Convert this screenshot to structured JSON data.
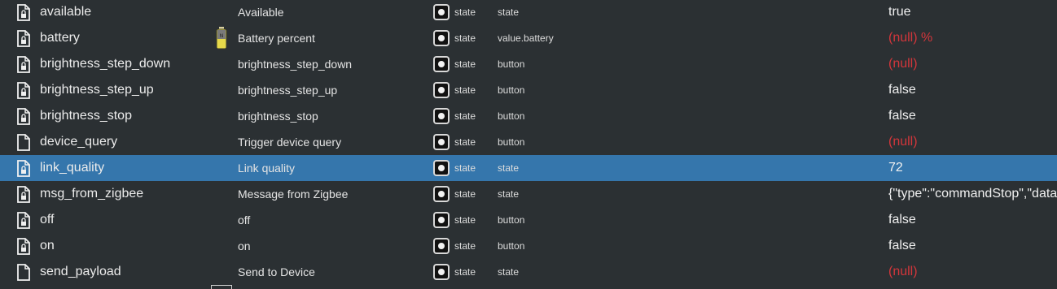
{
  "rows": [
    {
      "id": "available",
      "name": "Available",
      "type": "state",
      "role": "state",
      "value": "true",
      "value_kind": "normal",
      "locked": true,
      "role_icon": ""
    },
    {
      "id": "battery",
      "name": "Battery percent",
      "type": "state",
      "role": "value.battery",
      "value": "(null) %",
      "value_kind": "null",
      "locked": true,
      "role_icon": "battery-icon"
    },
    {
      "id": "brightness_step_down",
      "name": "brightness_step_down",
      "type": "state",
      "role": "button",
      "value": "(null)",
      "value_kind": "null",
      "locked": true,
      "role_icon": ""
    },
    {
      "id": "brightness_step_up",
      "name": "brightness_step_up",
      "type": "state",
      "role": "button",
      "value": "false",
      "value_kind": "normal",
      "locked": true,
      "role_icon": ""
    },
    {
      "id": "brightness_stop",
      "name": "brightness_stop",
      "type": "state",
      "role": "button",
      "value": "false",
      "value_kind": "normal",
      "locked": true,
      "role_icon": ""
    },
    {
      "id": "device_query",
      "name": "Trigger device query",
      "type": "state",
      "role": "button",
      "value": "(null)",
      "value_kind": "null",
      "locked": false,
      "role_icon": ""
    },
    {
      "id": "link_quality",
      "name": "Link quality",
      "type": "state",
      "role": "state",
      "value": "72",
      "value_kind": "normal",
      "locked": true,
      "role_icon": "",
      "selected": true
    },
    {
      "id": "msg_from_zigbee",
      "name": "Message from Zigbee",
      "type": "state",
      "role": "state",
      "value": "{\"type\":\"commandStop\",\"data",
      "value_kind": "normal",
      "locked": true,
      "role_icon": ""
    },
    {
      "id": "off",
      "name": "off",
      "type": "state",
      "role": "button",
      "value": "false",
      "value_kind": "normal",
      "locked": true,
      "role_icon": ""
    },
    {
      "id": "on",
      "name": "on",
      "type": "state",
      "role": "button",
      "value": "false",
      "value_kind": "normal",
      "locked": true,
      "role_icon": ""
    },
    {
      "id": "send_payload",
      "name": "Send to Device",
      "type": "state",
      "role": "state",
      "value": "(null)",
      "value_kind": "null",
      "locked": false,
      "role_icon": ""
    }
  ],
  "colors": {
    "background": "#2b3033",
    "selected_row": "#3576ac",
    "null_value": "#d4363b"
  }
}
